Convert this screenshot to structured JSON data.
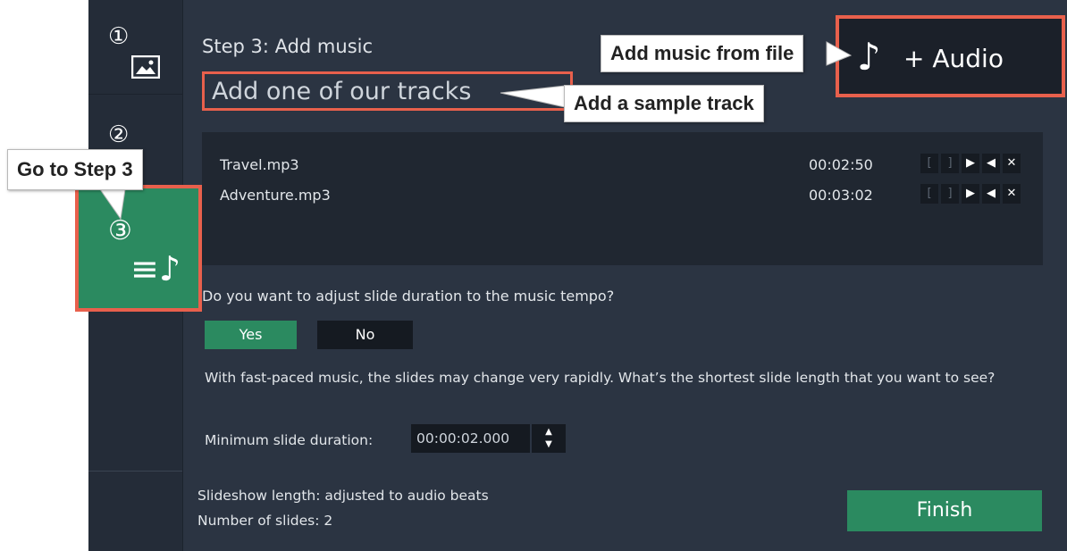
{
  "header": {
    "step_title": "Step 3: Add music",
    "sample_tracks_link": "Add one of our tracks",
    "audio_button": "+ Audio",
    "audio_icon": "music-note-icon"
  },
  "sidebar": {
    "step1_num": "①",
    "step2_num": "②",
    "step3_num": "③",
    "step3_icon": "≡♪"
  },
  "tracks": [
    {
      "name": "Travel.mp3",
      "duration": "00:02:50"
    },
    {
      "name": "Adventure.mp3",
      "duration": "00:03:02"
    }
  ],
  "track_controls": {
    "mark_in": "[",
    "mark_out": "]",
    "play": "▶",
    "mute": "◀",
    "remove": "✕"
  },
  "tempo": {
    "question": "Do you want to adjust slide duration to the music tempo?",
    "yes_label": "Yes",
    "no_label": "No",
    "note": "With fast-paced music, the slides may change very rapidly. What’s the shortest slide length that you want to see?",
    "min_label": "Minimum slide duration:",
    "min_value": "00:00:02.000"
  },
  "footer": {
    "length": "Slideshow length: adjusted to audio beats",
    "count": "Number of slides: 2",
    "finish_label": "Finish"
  },
  "callouts": {
    "from_file": "Add music from file",
    "sample": "Add a sample track",
    "go_step3": "Go to Step 3"
  },
  "colors": {
    "accent_green": "#2b8a60",
    "highlight": "#e8604c",
    "panel": "#2b3442"
  }
}
